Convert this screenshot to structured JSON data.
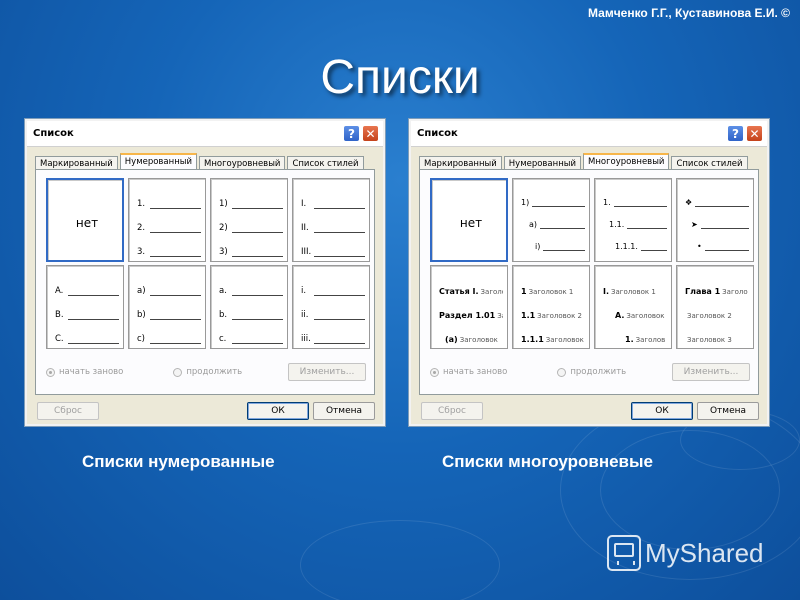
{
  "author": "Мамченко Г.Г., Куставинова Е.И. ©",
  "title": "Списки",
  "captions": {
    "left": "Списки нумерованные",
    "right": "Списки многоуровневые"
  },
  "watermark": "MyShared",
  "dialog_numbered": {
    "title": "Список",
    "help_label": "?",
    "close_label": "✕",
    "tabs": [
      "Маркированный",
      "Нумерованный",
      "Многоуровневый",
      "Список стилей"
    ],
    "active_tab": 1,
    "none_label": "нет",
    "presets": [
      [
        "1.",
        "2.",
        "3."
      ],
      [
        "1)",
        "2)",
        "3)"
      ],
      [
        "I.",
        "II.",
        "III."
      ],
      [
        "A.",
        "B.",
        "C."
      ],
      [
        "a)",
        "b)",
        "c)"
      ],
      [
        "a.",
        "b.",
        "c."
      ],
      [
        "i.",
        "ii.",
        "iii."
      ]
    ],
    "radio_restart": "начать заново",
    "radio_continue": "продолжить",
    "change_button": "Изменить...",
    "reset_button": "Сброс",
    "ok_button": "ОК",
    "cancel_button": "Отмена"
  },
  "dialog_multilevel": {
    "title": "Список",
    "help_label": "?",
    "close_label": "✕",
    "tabs": [
      "Маркированный",
      "Нумерованный",
      "Многоуровневый",
      "Список стилей"
    ],
    "active_tab": 2,
    "none_label": "нет",
    "preset_numbers": [
      "1)",
      "a)",
      "i)"
    ],
    "preset_decimal": [
      "1.",
      "1.1.",
      "1.1.1."
    ],
    "preset_bullets": [
      "❖",
      "➤",
      "•"
    ],
    "preset_article": [
      {
        "mk": "Статья I.",
        "hd": "Заголо"
      },
      {
        "mk": "Раздел 1.01",
        "hd": "За"
      },
      {
        "mk": "(a)",
        "hd": "Заголовок"
      }
    ],
    "preset_heading_decimal": [
      {
        "mk": "1",
        "hd": "Заголовок 1"
      },
      {
        "mk": "1.1",
        "hd": "Заголовок 2"
      },
      {
        "mk": "1.1.1",
        "hd": "Заголовок"
      }
    ],
    "preset_heading_roman": [
      {
        "mk": "I.",
        "hd": "Заголовок 1"
      },
      {
        "mk": "A.",
        "hd": "Заголовок"
      },
      {
        "mk": "1.",
        "hd": "Заголов"
      }
    ],
    "preset_chapter": [
      {
        "mk": "Глава 1",
        "hd": "Заголо"
      },
      {
        "mk": "",
        "hd": "Заголовок 2"
      },
      {
        "mk": "",
        "hd": "Заголовок 3"
      }
    ],
    "radio_restart": "начать заново",
    "radio_continue": "продолжить",
    "change_button": "Изменить...",
    "reset_button": "Сброс",
    "ok_button": "ОК",
    "cancel_button": "Отмена"
  }
}
